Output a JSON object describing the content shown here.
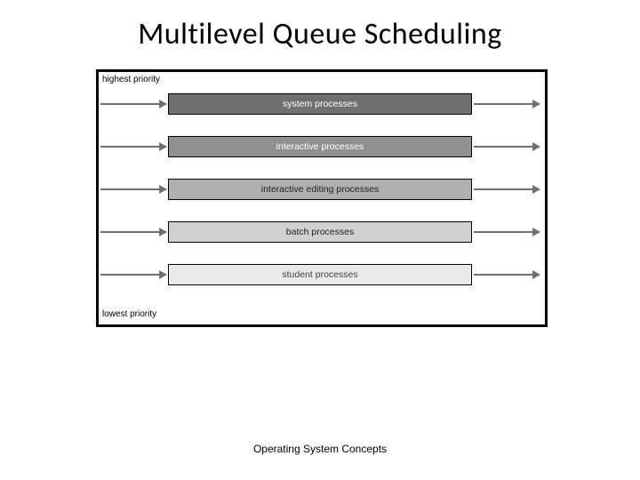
{
  "slide": {
    "title": "Multilevel Queue Scheduling",
    "top_priority_label": "highest priority",
    "bottom_priority_label": "lowest priority",
    "queues": [
      {
        "label": "system processes",
        "bg": "#6f7074",
        "text_class": "dark"
      },
      {
        "label": "interactive processes",
        "bg": "#8f9093",
        "text_class": "dark"
      },
      {
        "label": "interactive editing processes",
        "bg": "#aeafb1",
        "text_class": "mid"
      },
      {
        "label": "batch processes",
        "bg": "#cfd0d1",
        "text_class": "mid"
      },
      {
        "label": "student processes",
        "bg": "#e8e9ea",
        "text_class": "lite"
      }
    ],
    "footer": "Operating System Concepts"
  }
}
